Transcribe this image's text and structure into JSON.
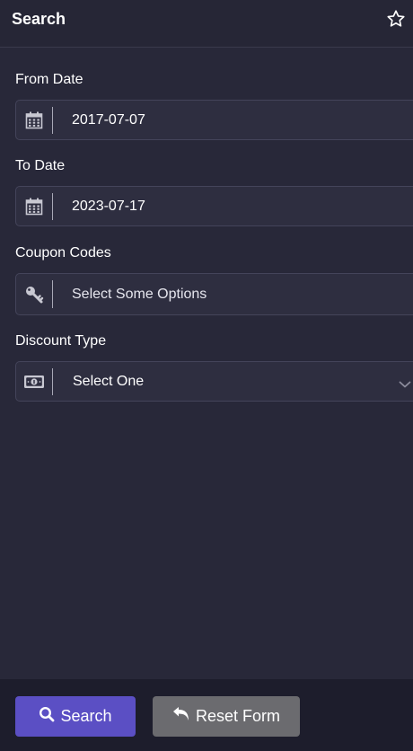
{
  "header": {
    "title": "Search",
    "favorite_icon": "star-outline-icon"
  },
  "form": {
    "from_date": {
      "label": "From Date",
      "value": "2017-07-07",
      "icon": "calendar-icon"
    },
    "to_date": {
      "label": "To Date",
      "value": "2023-07-17",
      "icon": "calendar-icon"
    },
    "coupon_codes": {
      "label": "Coupon Codes",
      "placeholder": "Select Some Options",
      "icon": "key-icon"
    },
    "discount_type": {
      "label": "Discount Type",
      "value": "Select One",
      "icon": "money-bill-icon"
    }
  },
  "footer": {
    "search_label": "Search",
    "search_icon": "magnifier-icon",
    "reset_label": "Reset Form",
    "reset_icon": "undo-arrow-icon"
  },
  "colors": {
    "background": "#282839",
    "field_background": "#2e2e40",
    "search_button": "#5b4fc4",
    "reset_button": "#6b6b6f",
    "footer_background": "#1d1d2c"
  }
}
